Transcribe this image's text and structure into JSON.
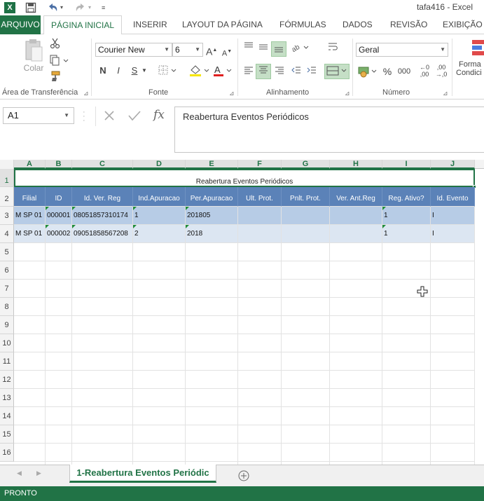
{
  "window": {
    "title": "tafa416 - Excel",
    "app_icon": "X"
  },
  "quick_access": {
    "save_icon": "save-icon",
    "undo_icon": "undo-icon",
    "redo_icon": "redo-icon",
    "customize_icon": "customize-icon"
  },
  "tabs": {
    "file": "ARQUIVO",
    "home": "PÁGINA INICIAL",
    "insert": "INSERIR",
    "layout": "LAYOUT DA PÁGINA",
    "formulas": "FÓRMULAS",
    "data": "DADOS",
    "review": "REVISÃO",
    "view": "EXIBIÇÃO"
  },
  "ribbon": {
    "clipboard": {
      "label": "Área de Transferência",
      "paste": "Colar"
    },
    "font": {
      "label": "Fonte",
      "name": "Courier New",
      "size": "6",
      "bold": "N",
      "italic": "I",
      "underline": "S"
    },
    "alignment": {
      "label": "Alinhamento"
    },
    "number": {
      "label": "Número",
      "format": "Geral",
      "thousands": "000"
    },
    "styles": {
      "label_line1": "Forma",
      "label_line2": "Condici"
    }
  },
  "formula_bar": {
    "name_box": "A1",
    "fx": "fx",
    "content": "Reabertura Eventos Periódicos"
  },
  "columns": [
    "A",
    "B",
    "C",
    "D",
    "E",
    "F",
    "G",
    "H",
    "I",
    "J"
  ],
  "rows": [
    "1",
    "2",
    "3",
    "4",
    "5",
    "6",
    "7",
    "8",
    "9",
    "10",
    "11",
    "12",
    "13",
    "14",
    "15",
    "16"
  ],
  "sheet_title": "Reabertura Eventos Periódicos",
  "table": {
    "headers": [
      "Filial",
      "ID",
      "Id. Ver. Reg",
      "Ind.Apuracao",
      "Per.Apuracao",
      "Ult. Prot.",
      "Pnlt. Prot.",
      "Ver. Ant.Reg",
      "Reg. Ativo?",
      "Id. Evento"
    ],
    "rows": [
      [
        "M SP 01",
        "000001",
        "08051857310174",
        "1",
        "201805",
        "",
        "",
        "",
        "1",
        "I"
      ],
      [
        "M SP 01",
        "000002",
        "09051858567208",
        "2",
        "2018",
        "",
        "",
        "",
        "1",
        "I"
      ]
    ]
  },
  "sheet_tab": "1-Reabertura Eventos Periódic",
  "status": "PRONTO",
  "colors": {
    "excel_green": "#217346",
    "header_blue": "#5b82b8",
    "row_band_dark": "#b7cce6",
    "row_band_light": "#dce6f2"
  }
}
